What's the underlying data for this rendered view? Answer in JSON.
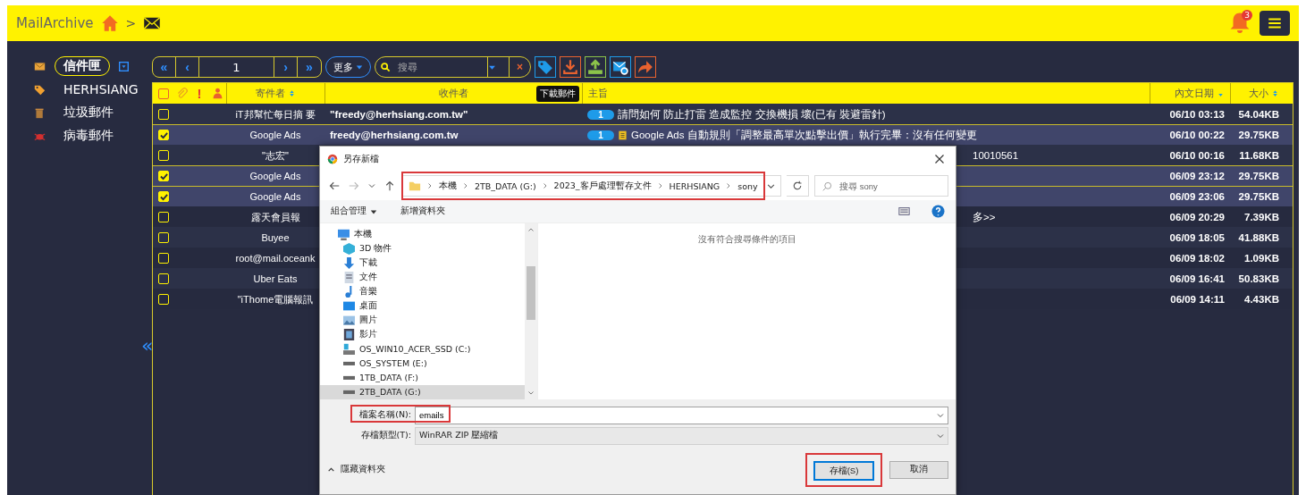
{
  "topbar": {
    "brand": "MailArchive",
    "separator": ">",
    "notifications": "3"
  },
  "sidebar": {
    "items": [
      {
        "label": "信件匣",
        "kind": "inbox",
        "selected": true
      },
      {
        "label": "HERHSIANG",
        "kind": "tag",
        "selected": false
      },
      {
        "label": "垃圾郵件",
        "kind": "junk",
        "selected": false
      },
      {
        "label": "病毒郵件",
        "kind": "virus",
        "selected": false
      }
    ],
    "collapse": "«"
  },
  "toolbar": {
    "first": "«",
    "prev": "‹",
    "page": "1",
    "next": "›",
    "last": "»",
    "more": "更多",
    "search": {
      "placeholder": "搜尋"
    },
    "clear": "×",
    "actions": [
      {
        "kind": "tag"
      },
      {
        "kind": "download"
      },
      {
        "kind": "upload"
      },
      {
        "kind": "mail-search"
      },
      {
        "kind": "forward"
      }
    ],
    "tooltip": "下載郵件"
  },
  "table": {
    "header": {
      "checked": false,
      "important": "!",
      "columns": [
        "寄件者",
        "收件者",
        "主旨",
        "內文日期",
        "大小"
      ]
    },
    "rows": [
      {
        "checked": false,
        "sender": "iT邦幫忙每日摘 要",
        "recipient": "\"freedy@herhsiang.com.tw\"",
        "count": "1",
        "note_icon": false,
        "subject": "請問如何 防止打雷 造成監控 交換機損 壞(已有 裝避雷針)",
        "date": "06/10 03:13",
        "size": "54.04KB"
      },
      {
        "checked": true,
        "sender": "Google Ads",
        "recipient": "freedy@herhsiang.com.tw",
        "count": "1",
        "note_icon": true,
        "subject": "Google Ads 自動規則「調整最高單次點擊出價」執行完畢：沒有任何變更",
        "date": "06/10 00:22",
        "size": "29.75KB"
      },
      {
        "checked": false,
        "sender": "\"志宏\"",
        "subject": "10010561",
        "date": "06/10 00:16",
        "size": "11.68KB"
      },
      {
        "checked": true,
        "sender": "Google Ads",
        "date": "06/09 23:12",
        "size": "29.75KB"
      },
      {
        "checked": true,
        "sender": "Google Ads",
        "date": "06/09 23:06",
        "size": "29.75KB"
      },
      {
        "checked": false,
        "sender": "露天會員報",
        "subject": "多>>",
        "date": "06/09 20:29",
        "size": "7.39KB"
      },
      {
        "checked": false,
        "sender": "Buyee",
        "date": "06/09 18:05",
        "size": "41.88KB"
      },
      {
        "checked": false,
        "sender": "root@mail.oceank",
        "date": "06/09 18:02",
        "size": "1.09KB"
      },
      {
        "checked": false,
        "sender": "Uber Eats",
        "date": "06/09 16:41",
        "size": "50.83KB"
      },
      {
        "checked": false,
        "sender": "\"iThome電腦報訊",
        "date": "06/09 14:11",
        "size": "4.43KB"
      }
    ]
  },
  "dialog": {
    "title": "另存新檔",
    "path": [
      "本機",
      "2TB_DATA (G:)",
      "2023_客戶處理暫存文件",
      "HERHSIANG",
      "sony"
    ],
    "path_highlighted": true,
    "search": {
      "placeholder": "搜尋 sony"
    },
    "organize": "組合管理",
    "new_folder": "新增資料夾",
    "nav_tree": [
      {
        "label": "本機",
        "kind": "pc",
        "selected": false,
        "children": [
          {
            "label": "3D 物件",
            "kind": "cube",
            "selected": false
          },
          {
            "label": "下載",
            "kind": "download",
            "selected": false
          },
          {
            "label": "文件",
            "kind": "document",
            "selected": false
          },
          {
            "label": "音樂",
            "kind": "music",
            "selected": false
          },
          {
            "label": "桌面",
            "kind": "desktop",
            "selected": false
          },
          {
            "label": "圖片",
            "kind": "picture",
            "selected": false
          },
          {
            "label": "影片",
            "kind": "video",
            "selected": false
          },
          {
            "label": "OS_WIN10_ACER_SSD (C:)",
            "kind": "system-drive",
            "selected": false
          },
          {
            "label": "OS_SYSTEM (E:)",
            "kind": "drive",
            "selected": false
          },
          {
            "label": "1TB_DATA (F:)",
            "kind": "drive",
            "selected": false
          },
          {
            "label": "2TB_DATA (G:)",
            "kind": "drive",
            "selected": true
          }
        ]
      }
    ],
    "empty_message": "沒有符合搜尋條件的項目",
    "file_name": {
      "label": "檔案名稱(N):",
      "value": "emails",
      "highlighted": true
    },
    "file_type": {
      "label": "存檔類型(T):",
      "value": "WinRAR ZIP 壓縮檔"
    },
    "save": {
      "label": "存檔(S)",
      "highlighted": true
    },
    "cancel": "取消",
    "hide_folders": "隱藏資料夾"
  }
}
